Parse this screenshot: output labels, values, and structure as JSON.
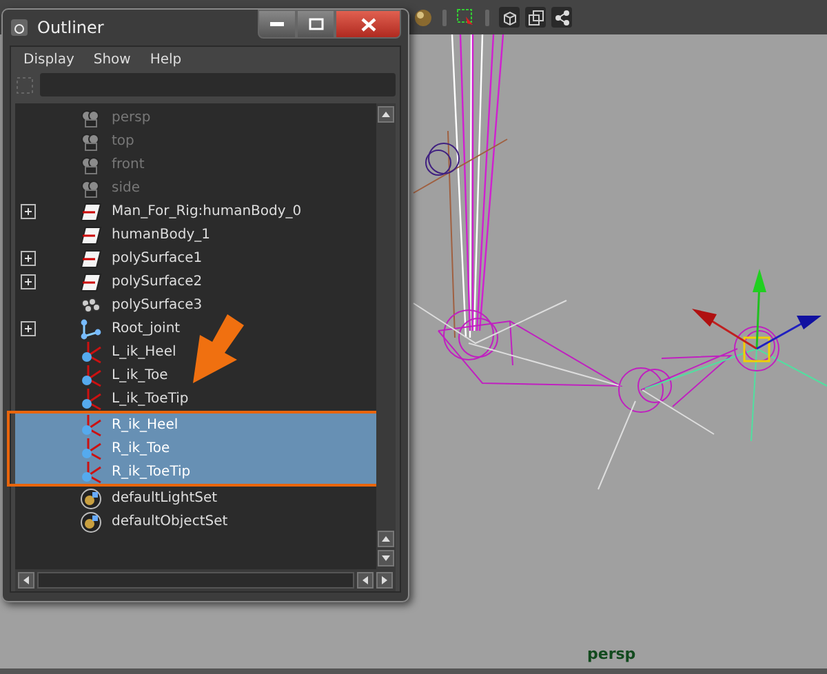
{
  "window": {
    "title": "Outliner"
  },
  "menu": [
    "Display",
    "Show",
    "Help"
  ],
  "items": [
    {
      "label": "persp",
      "kind": "camera",
      "hidden": true,
      "expandable": false,
      "selected": false
    },
    {
      "label": "top",
      "kind": "camera",
      "hidden": true,
      "expandable": false,
      "selected": false
    },
    {
      "label": "front",
      "kind": "camera",
      "hidden": true,
      "expandable": false,
      "selected": false
    },
    {
      "label": "side",
      "kind": "camera",
      "hidden": true,
      "expandable": false,
      "selected": false
    },
    {
      "label": "Man_For_Rig:humanBody_0",
      "kind": "mesh",
      "hidden": false,
      "expandable": true,
      "selected": false
    },
    {
      "label": "humanBody_1",
      "kind": "mesh",
      "hidden": false,
      "expandable": false,
      "selected": false
    },
    {
      "label": "polySurface1",
      "kind": "mesh",
      "hidden": false,
      "expandable": true,
      "selected": false
    },
    {
      "label": "polySurface2",
      "kind": "mesh",
      "hidden": false,
      "expandable": true,
      "selected": false
    },
    {
      "label": "polySurface3",
      "kind": "group",
      "hidden": false,
      "expandable": false,
      "selected": false
    },
    {
      "label": "Root_joint",
      "kind": "joint",
      "hidden": false,
      "expandable": true,
      "selected": false
    },
    {
      "label": "L_ik_Heel",
      "kind": "ik",
      "hidden": false,
      "expandable": false,
      "selected": false
    },
    {
      "label": "L_ik_Toe",
      "kind": "ik",
      "hidden": false,
      "expandable": false,
      "selected": false
    },
    {
      "label": "L_ik_ToeTip",
      "kind": "ik",
      "hidden": false,
      "expandable": false,
      "selected": false
    },
    {
      "label": "R_ik_Heel",
      "kind": "ik",
      "hidden": false,
      "expandable": false,
      "selected": true
    },
    {
      "label": "R_ik_Toe",
      "kind": "ik",
      "hidden": false,
      "expandable": false,
      "selected": true
    },
    {
      "label": "R_ik_ToeTip",
      "kind": "ik",
      "hidden": false,
      "expandable": false,
      "selected": true
    },
    {
      "label": "defaultLightSet",
      "kind": "set",
      "hidden": false,
      "expandable": false,
      "selected": false
    },
    {
      "label": "defaultObjectSet",
      "kind": "set",
      "hidden": false,
      "expandable": false,
      "selected": false
    }
  ],
  "viewport": {
    "camera": "persp"
  }
}
